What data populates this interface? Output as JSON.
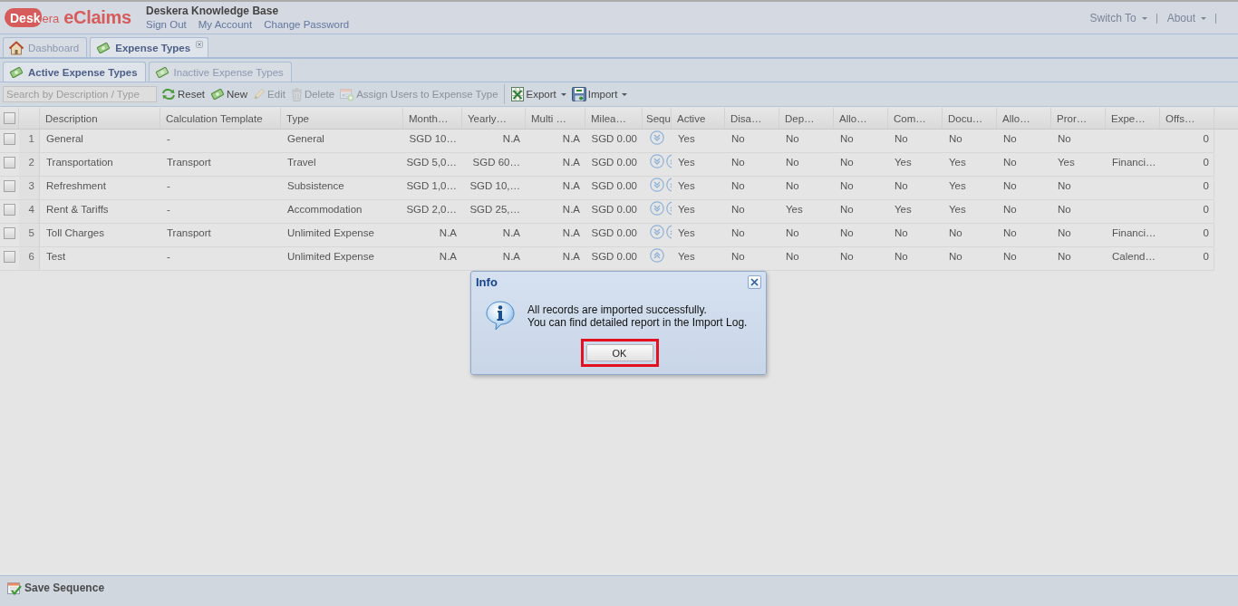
{
  "header": {
    "logo": {
      "mark": "Desk",
      "suffix": "era",
      "product": "eClaims"
    },
    "site_title": "Deskera Knowledge Base",
    "links": [
      "Sign Out",
      "My Account",
      "Change Password"
    ],
    "menus": [
      "Switch To",
      "About"
    ]
  },
  "main_tabs": [
    {
      "label": "Dashboard",
      "kind": "home",
      "selected": false,
      "closable": false
    },
    {
      "label": "Expense Types",
      "kind": "money",
      "selected": true,
      "closable": true
    }
  ],
  "sub_tabs": [
    {
      "label": "Active Expense Types",
      "selected": true
    },
    {
      "label": "Inactive Expense Types",
      "selected": false
    }
  ],
  "toolbar": {
    "search": {
      "placeholder": "Search by Description / Type"
    },
    "buttons": [
      {
        "label": "Reset",
        "kind": "reset",
        "disabled": false,
        "dropdown": false,
        "separator_before": false
      },
      {
        "label": "New",
        "kind": "new",
        "disabled": false,
        "dropdown": false,
        "separator_before": false
      },
      {
        "label": "Edit",
        "kind": "edit",
        "disabled": true,
        "dropdown": false,
        "separator_before": false
      },
      {
        "label": "Delete",
        "kind": "delete",
        "disabled": true,
        "dropdown": false,
        "separator_before": false
      },
      {
        "label": "Assign Users to Expense Type",
        "kind": "assign",
        "disabled": true,
        "dropdown": false,
        "separator_before": false
      },
      {
        "label": "Export",
        "kind": "export",
        "disabled": false,
        "dropdown": true,
        "separator_before": true
      },
      {
        "label": "Import",
        "kind": "import",
        "disabled": false,
        "dropdown": true,
        "separator_before": false
      }
    ]
  },
  "grid": {
    "select_all_checked": false,
    "columns": [
      "Description",
      "Calculation Template",
      "Type",
      "Month…",
      "Yearly…",
      "Multi …",
      "Milea…",
      "Sequ",
      "Active",
      "Disa…",
      "Dep…",
      "Allo…",
      "Com…",
      "Docu…",
      "Allo…",
      "Pror…",
      "Expe…",
      "Offs…"
    ],
    "rows": [
      {
        "number": "1",
        "checked": false,
        "move_down": true,
        "move_up": false,
        "cells": [
          "General",
          "-",
          "General",
          "SGD 10…",
          "N.A",
          "N.A",
          "SGD 0.00",
          "",
          "Yes",
          "No",
          "No",
          "No",
          "No",
          "No",
          "No",
          "No",
          "",
          "0"
        ]
      },
      {
        "number": "2",
        "checked": false,
        "move_down": true,
        "move_up": true,
        "cells": [
          "Transportation",
          "Transport",
          "Travel",
          "SGD 5,0…",
          "SGD 60…",
          "N.A",
          "SGD 0.00",
          "",
          "Yes",
          "No",
          "No",
          "No",
          "Yes",
          "Yes",
          "No",
          "Yes",
          "Financi…",
          "0"
        ]
      },
      {
        "number": "3",
        "checked": false,
        "move_down": true,
        "move_up": true,
        "cells": [
          "Refreshment",
          "-",
          "Subsistence",
          "SGD 1,0…",
          "SGD 10,…",
          "N.A",
          "SGD 0.00",
          "",
          "Yes",
          "No",
          "No",
          "No",
          "No",
          "Yes",
          "No",
          "No",
          "",
          "0"
        ]
      },
      {
        "number": "4",
        "checked": false,
        "move_down": true,
        "move_up": true,
        "cells": [
          "Rent & Tariffs",
          "-",
          "Accommodation",
          "SGD 2,0…",
          "SGD 25,…",
          "N.A",
          "SGD 0.00",
          "",
          "Yes",
          "No",
          "Yes",
          "No",
          "Yes",
          "Yes",
          "No",
          "No",
          "",
          "0"
        ]
      },
      {
        "number": "5",
        "checked": false,
        "move_down": true,
        "move_up": true,
        "cells": [
          "Toll Charges",
          "Transport",
          "Unlimited Expense",
          "N.A",
          "N.A",
          "N.A",
          "SGD 0.00",
          "",
          "Yes",
          "No",
          "No",
          "No",
          "No",
          "No",
          "No",
          "No",
          "Financi…",
          "0"
        ]
      },
      {
        "number": "6",
        "checked": false,
        "move_down": false,
        "move_up": true,
        "cells": [
          "Test",
          "-",
          "Unlimited Expense",
          "N.A",
          "N.A",
          "N.A",
          "SGD 0.00",
          "",
          "Yes",
          "No",
          "No",
          "No",
          "No",
          "No",
          "No",
          "No",
          "Calend…",
          "0"
        ]
      }
    ]
  },
  "bottom_bar": {
    "button": "Save Sequence"
  },
  "dialog": {
    "title": "Info",
    "lines": [
      "All records are imported successfully.",
      "You can find detailed report in the Import Log."
    ],
    "button": "OK",
    "button_highlighted": true
  }
}
